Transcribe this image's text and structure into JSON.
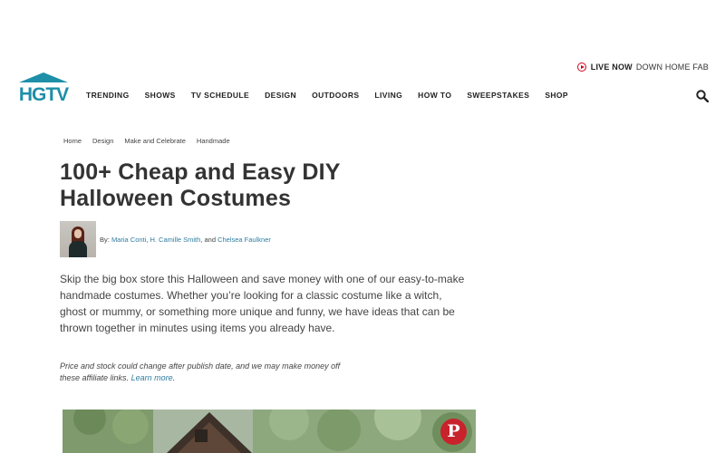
{
  "brand": {
    "logo_text": "HGTV",
    "color": "#1e8fa8"
  },
  "live": {
    "label": "LIVE NOW",
    "show": "DOWN HOME FAB",
    "icon": "play-circle-icon",
    "color": "#d0021b"
  },
  "nav": {
    "items": [
      "TRENDING",
      "SHOWS",
      "TV SCHEDULE",
      "DESIGN",
      "OUTDOORS",
      "LIVING",
      "HOW TO",
      "SWEEPSTAKES",
      "SHOP"
    ],
    "search_icon": "search-icon"
  },
  "breadcrumb": [
    "Home",
    "Design",
    "Make and Celebrate",
    "Handmade"
  ],
  "article": {
    "title": "100+ Cheap and Easy DIY Halloween Costumes",
    "byline_prefix": "By:",
    "authors": [
      "Maria Conti",
      "H. Camille Smith",
      "Chelsea Faulkner"
    ],
    "author_sep": ", ",
    "author_and": ", and ",
    "intro": "Skip the big box store this Halloween and save money with one of our easy-to-make handmade costumes. Whether you’re looking for a classic costume like a witch, ghost or mummy, or something more unique and funny, we have ideas that can be thrown together in minutes using items you already have.",
    "affiliate_note": "Price and stock could change after publish date, and we may make money off these affiliate links.",
    "affiliate_link": "Learn more",
    "affiliate_end": ".",
    "link_color": "#2f7da0"
  },
  "pinterest": {
    "icon": "pinterest-icon",
    "glyph": "P",
    "color": "#c8232c"
  }
}
